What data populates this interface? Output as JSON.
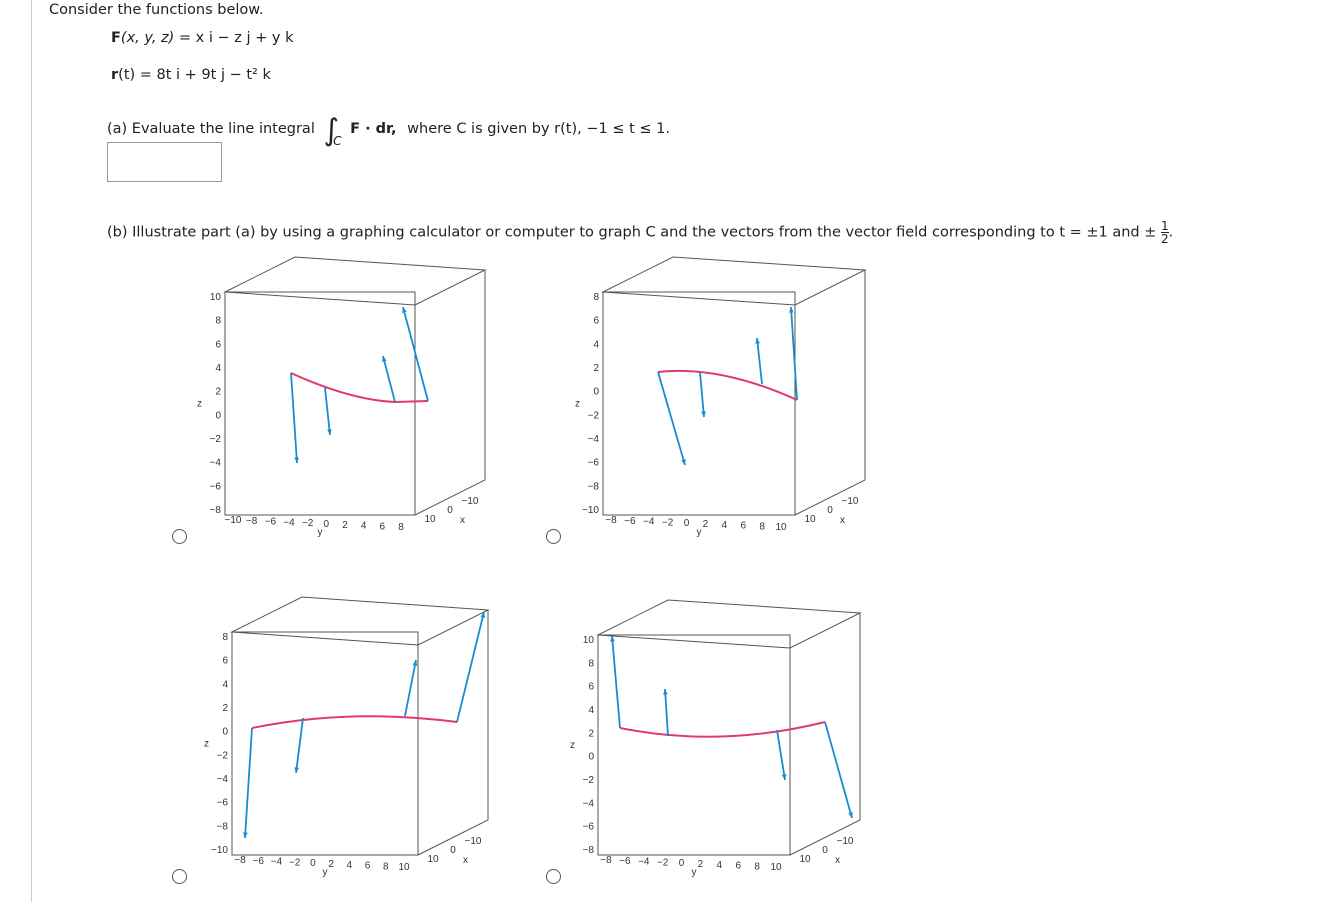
{
  "intro": "Consider the functions below.",
  "F_def": {
    "lhs": "F",
    "args": "(x, y, z) = ",
    "terms": "x i − z j + y k"
  },
  "r_def": {
    "lhs": "r",
    "args": "(t) = 8t i + 9t j − t² k"
  },
  "part_a": {
    "prefix": "(a) Evaluate the line integral",
    "integrand": "F · dr,",
    "suffix": "where C is given by  r(t), −1 ≤ t ≤ 1.",
    "subscript": "C",
    "answer_value": ""
  },
  "part_b": {
    "text": "(b) Illustrate part (a) by using a graphing calculator or computer to graph C and the vectors from the vector field corresponding to  t = ±1 and ±",
    "frac_num": "1",
    "frac_den": "2",
    "end": "."
  },
  "colors": {
    "curve": "#e03a6a",
    "vectors": "#1a8ad4",
    "box": "#555555"
  },
  "plots": [
    {
      "z_label": "z",
      "y_label": "y",
      "x_label": "x",
      "z_ticks": [
        "10",
        "8",
        "6",
        "4",
        "2",
        "0",
        "−2",
        "−4",
        "−6",
        "−8"
      ],
      "y_ticks": [
        "−10",
        "−8",
        "−6",
        "−4",
        "−2",
        "0",
        "2",
        "4",
        "6",
        "8"
      ],
      "x_ticks": [
        "10",
        "0",
        "−10"
      ]
    },
    {
      "z_label": "z",
      "y_label": "y",
      "x_label": "x",
      "z_ticks": [
        "8",
        "6",
        "4",
        "2",
        "0",
        "−2",
        "−4",
        "−6",
        "−8",
        "−10"
      ],
      "y_ticks": [
        "−8",
        "−6",
        "−4",
        "−2",
        "0",
        "2",
        "4",
        "6",
        "8",
        "10"
      ],
      "x_ticks": [
        "10",
        "0",
        "−10"
      ]
    },
    {
      "z_label": "z",
      "y_label": "y",
      "x_label": "x",
      "z_ticks": [
        "8",
        "6",
        "4",
        "2",
        "0",
        "−2",
        "−4",
        "−6",
        "−8",
        "−10"
      ],
      "y_ticks": [
        "−8",
        "−6",
        "−4",
        "−2",
        "0",
        "2",
        "4",
        "6",
        "8",
        "10"
      ],
      "x_ticks": [
        "10",
        "0",
        "−10"
      ]
    },
    {
      "z_label": "z",
      "y_label": "y",
      "x_label": "x",
      "z_ticks": [
        "10",
        "8",
        "6",
        "4",
        "2",
        "0",
        "−2",
        "−4",
        "−6",
        "−8"
      ],
      "y_ticks": [
        "−8",
        "−6",
        "−4",
        "−2",
        "0",
        "2",
        "4",
        "6",
        "8",
        "10"
      ],
      "x_ticks": [
        "10",
        "0",
        "−10"
      ]
    }
  ]
}
